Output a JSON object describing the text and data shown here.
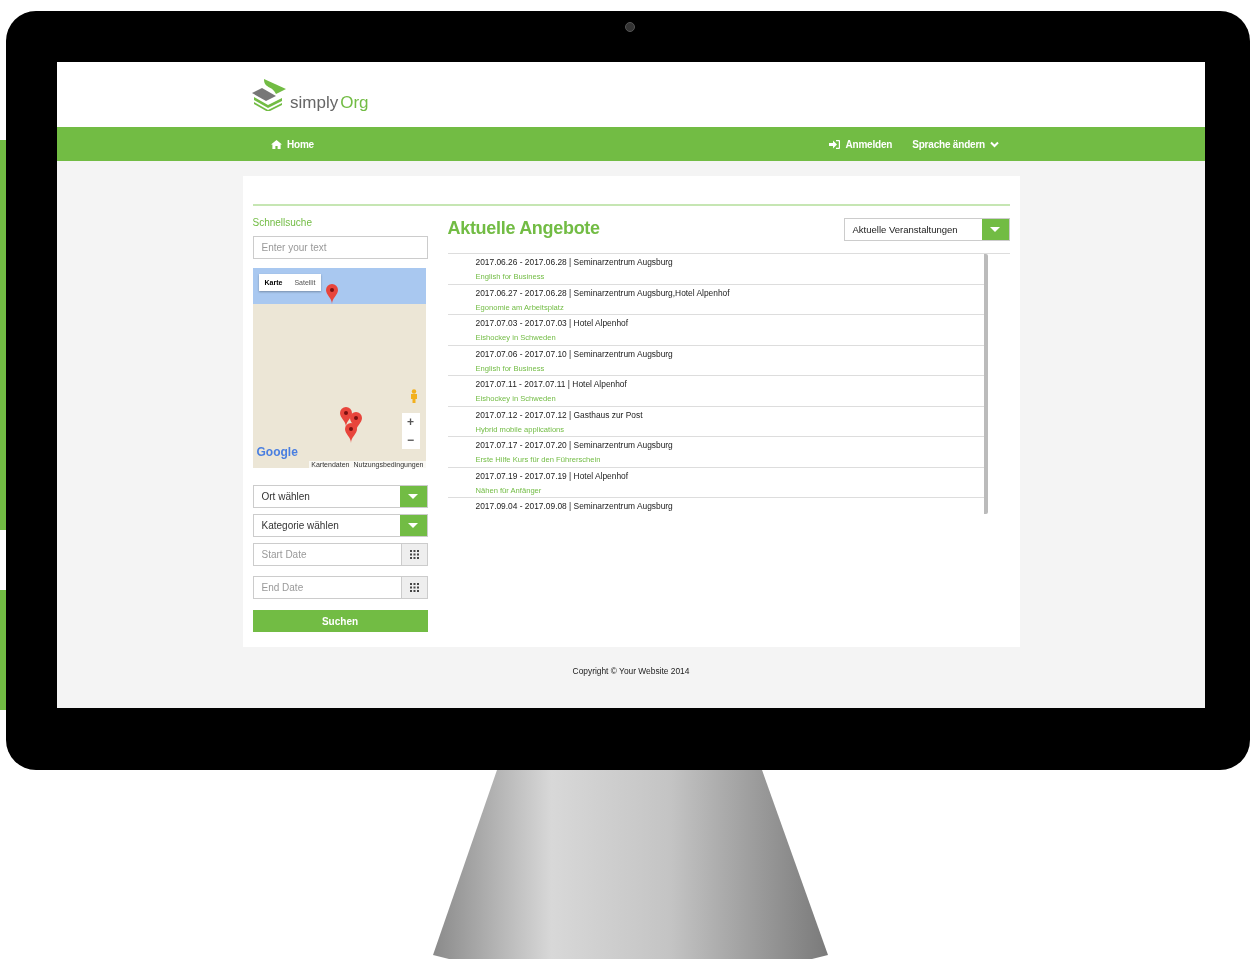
{
  "logo": {
    "text_1": "simply",
    "text_2": "Org"
  },
  "nav": {
    "left": [
      {
        "label": "Home"
      }
    ],
    "right": [
      {
        "label": "Anmelden"
      },
      {
        "label": "Sprache ändern"
      }
    ]
  },
  "sidebar": {
    "heading": "Schnellsuche",
    "search": {
      "placeholder": "Enter your text"
    },
    "map": {
      "type_buttons": [
        {
          "label": "Karte",
          "selected": true
        },
        {
          "label": "Satellit",
          "selected": false
        }
      ],
      "zoom_buttons": [
        "+",
        "−"
      ],
      "logo": "Google",
      "attribution": [
        "Kartendaten",
        "Nutzungsbedingungen"
      ]
    },
    "selects": [
      {
        "value": "Ort wählen"
      },
      {
        "value": "Kategorie wählen"
      }
    ],
    "date_fields": [
      {
        "placeholder": "Start Date"
      },
      {
        "placeholder": "End Date"
      }
    ],
    "button": "Suchen"
  },
  "main": {
    "title": "Aktuelle Angebote",
    "dropdown": {
      "value": "Aktuelle Veranstaltungen"
    },
    "events": [
      {
        "dates_place": "2017.06.26 - 2017.06.28 | Seminarzentrum Augsburg",
        "title": "English for Business"
      },
      {
        "dates_place": "2017.06.27 - 2017.06.28 | Seminarzentrum Augsburg,Hotel Alpenhof",
        "title": "Egonomie am Arbeitsplatz"
      },
      {
        "dates_place": "2017.07.03 - 2017.07.03 | Hotel Alpenhof",
        "title": "Eishockey in Schweden"
      },
      {
        "dates_place": "2017.07.06 - 2017.07.10 | Seminarzentrum Augsburg",
        "title": "English for Business"
      },
      {
        "dates_place": "2017.07.11 - 2017.07.11 | Hotel Alpenhof",
        "title": "Eishockey in Schweden"
      },
      {
        "dates_place": "2017.07.12 - 2017.07.12 | Gasthaus zur Post",
        "title": "Hybrid mobile applications"
      },
      {
        "dates_place": "2017.07.17 - 2017.07.20 | Seminarzentrum Augsburg",
        "title": "Erste Hilfe Kurs für den Führerschein"
      },
      {
        "dates_place": "2017.07.19 - 2017.07.19 | Hotel Alpenhof",
        "title": "Nähen für Anfänger"
      },
      {
        "dates_place": "2017.09.04 - 2017.09.08 | Seminarzentrum Augsburg"
      }
    ]
  },
  "footer": {
    "copyright": "Copyright © Your Website 2014"
  }
}
